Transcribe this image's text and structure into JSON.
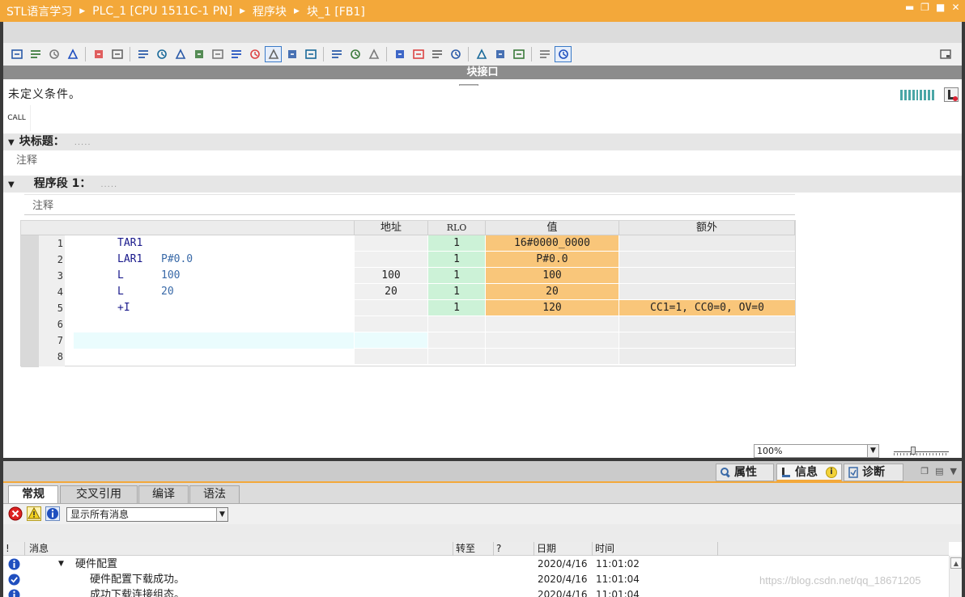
{
  "titlebar": {
    "crumbs": [
      "STL语言学习",
      "PLC_1 [CPU 1511C-1 PN]",
      "程序块",
      "块_1 [FB1]"
    ]
  },
  "toolbar": {
    "icons": [
      "insert-network-icon",
      "delete-network-icon",
      "open-all-networks-icon",
      "close-all-networks-icon",
      "jump-to-icon",
      "monitor-icon",
      "display-format-icon",
      "show-comments-icon",
      "insert-row-icon",
      "absolute-operands-icon",
      "favorites-icon",
      "call-structure-icon",
      "show-hide-icon",
      "insert-icon",
      "comment-icon",
      "status-icon",
      "clear-status-icon",
      "network-up-icon",
      "network-down-icon",
      "set-breakpoint-icon",
      "step-icon",
      "break-icon",
      "continue-icon",
      "go-to-icon",
      "compare-icon",
      "load-icon",
      "monitoring-icon",
      "watch-table-icon"
    ]
  },
  "interface_label": "块接口",
  "condition_text": "未定义条件。",
  "call_label": "CALL",
  "block_title": {
    "label": "块标题：",
    "dots": "....."
  },
  "block_comment": "注释",
  "network": {
    "label": "程序段 1：",
    "dots": ".....",
    "comment": "注释"
  },
  "grid": {
    "headers": {
      "address": "地址",
      "rlo": "RLO",
      "value": "值",
      "extra": "额外"
    },
    "rows": [
      {
        "n": "1",
        "op": "TAR1",
        "arg": "",
        "addr": "",
        "rlo": "1",
        "value": "16#0000_0000",
        "extra": ""
      },
      {
        "n": "2",
        "op": "LAR1",
        "arg": "P#0.0",
        "addr": "",
        "rlo": "1",
        "value": "P#0.0",
        "extra": ""
      },
      {
        "n": "3",
        "op": "L",
        "arg": "100",
        "addr": "100",
        "rlo": "1",
        "value": "100",
        "extra": ""
      },
      {
        "n": "4",
        "op": "L",
        "arg": "20",
        "addr": "20",
        "rlo": "1",
        "value": "20",
        "extra": ""
      },
      {
        "n": "5",
        "op": "+I",
        "arg": "",
        "addr": "",
        "rlo": "1",
        "value": "120",
        "extra": "CC1=1, CC0=0, OV=0"
      },
      {
        "n": "6",
        "op": "",
        "arg": "",
        "addr": "",
        "rlo": "",
        "value": "",
        "extra": ""
      },
      {
        "n": "7",
        "op": "",
        "arg": "",
        "addr": "",
        "rlo": "",
        "value": "",
        "extra": ""
      },
      {
        "n": "8",
        "op": "",
        "arg": "",
        "addr": "",
        "rlo": "",
        "value": "",
        "extra": ""
      }
    ]
  },
  "zoom": {
    "value": "100%"
  },
  "inspector": {
    "tabs": [
      {
        "label": "属性",
        "icon": "properties-icon"
      },
      {
        "label": "信息",
        "icon": "info-icon"
      },
      {
        "label": "诊断",
        "icon": "diagnostics-icon"
      }
    ],
    "info_badge": "i",
    "subtabs": [
      "常规",
      "交叉引用",
      "编译",
      "语法"
    ],
    "filter": {
      "selected": "显示所有消息"
    },
    "columns": [
      "!",
      "消息",
      "转至",
      "?",
      "日期",
      "时间"
    ],
    "messages": [
      {
        "icon": "info-icon",
        "text": "硬件配置",
        "date": "2020/4/16",
        "time": "11:01:02",
        "indent": 1,
        "expander": "▼"
      },
      {
        "icon": "success-icon",
        "text": "硬件配置下载成功。",
        "date": "2020/4/16",
        "time": "11:01:04",
        "indent": 2,
        "expander": ""
      },
      {
        "icon": "info-icon",
        "text": "成功下载连接组态。",
        "date": "2020/4/16",
        "time": "11:01:04",
        "indent": 2,
        "expander": ""
      }
    ]
  },
  "watermark": "https://blog.csdn.net/qq_18671205",
  "colors": {
    "accent": "#f3a83a",
    "rlo_fill": "#ccf2d7",
    "value_fill": "#f9c67a"
  }
}
